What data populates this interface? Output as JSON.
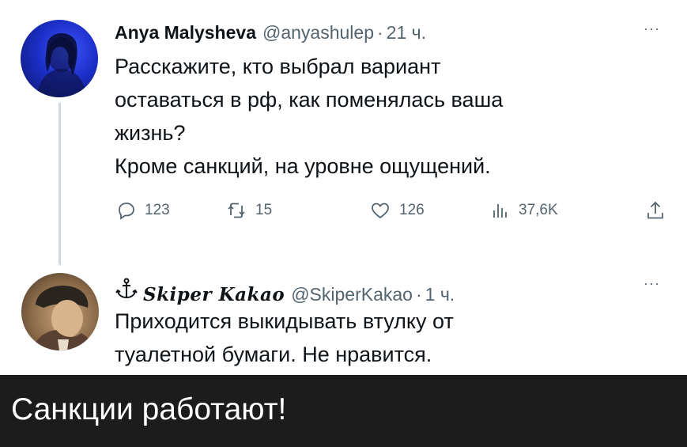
{
  "tweets": [
    {
      "author_name": "Anya Malysheva",
      "handle": "@anyashulep",
      "separator": "·",
      "time": "21 ч.",
      "more": "···",
      "text_lines": [
        "Расскажите, кто выбрал вариант",
        "оставаться в рф, как поменялась ваша",
        "жизнь?",
        "Кроме санкций, на уровне ощущений."
      ],
      "stats": {
        "replies": "123",
        "retweets": "15",
        "likes": "126",
        "views": "37,6K"
      },
      "icons": {
        "reply": "reply-icon",
        "retweet": "retweet-icon",
        "like": "heart-icon",
        "views": "views-icon",
        "share": "share-icon"
      }
    },
    {
      "author_name": "Skiper Kakao",
      "handle": "@SkiperKakao",
      "separator": "·",
      "time": "1 ч.",
      "more": "···",
      "name_icon": "anchor-icon",
      "text_lines": [
        "Приходится выкидывать втулку от",
        "туалетной бумаги. Не нравится."
      ]
    }
  ],
  "caption": "Санкции работают!",
  "colors": {
    "text_primary": "#0f1419",
    "text_secondary": "#536471",
    "thread_line": "#cfd9de",
    "caption_bg": "#1c1c1c",
    "caption_text": "#ffffff"
  }
}
